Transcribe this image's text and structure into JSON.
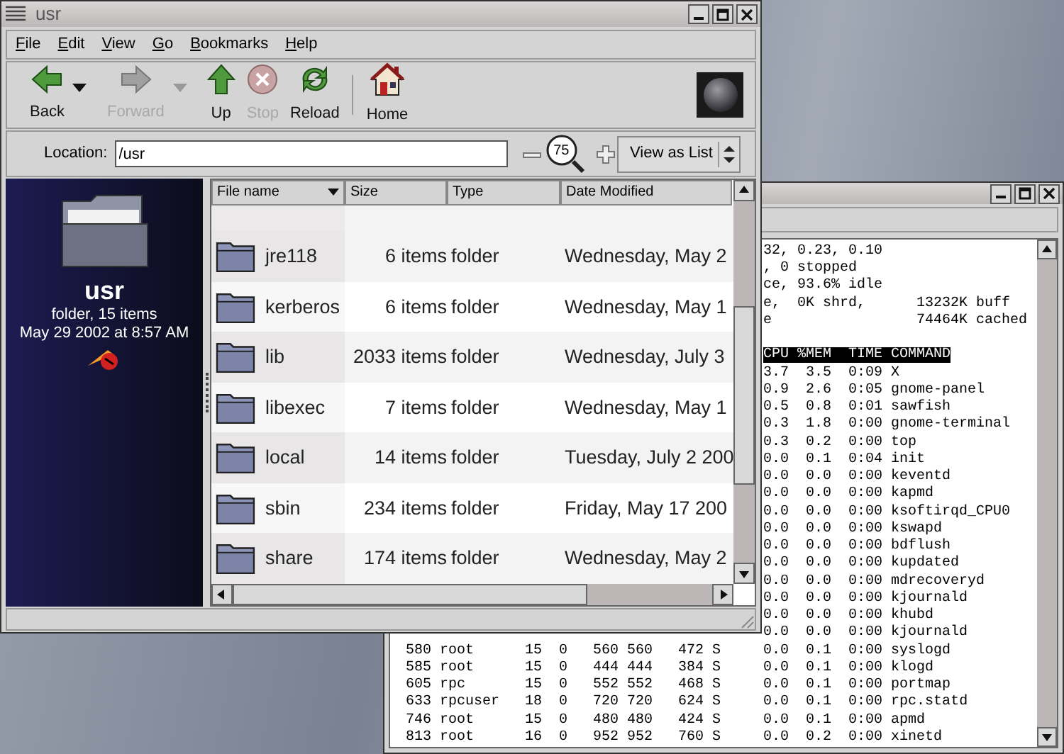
{
  "file_manager": {
    "title": "usr",
    "menu": [
      "File",
      "Edit",
      "View",
      "Go",
      "Bookmarks",
      "Help"
    ],
    "toolbar": [
      {
        "label": "Back",
        "kind": "back",
        "disabled": false,
        "dropdown": true
      },
      {
        "label": "Forward",
        "kind": "forward",
        "disabled": true,
        "dropdown": true
      },
      {
        "label": "Up",
        "kind": "up",
        "disabled": false,
        "dropdown": false
      },
      {
        "label": "Stop",
        "kind": "stop",
        "disabled": true,
        "dropdown": false
      },
      {
        "label": "Reload",
        "kind": "reload",
        "disabled": false,
        "dropdown": false
      },
      {
        "label": "Home",
        "kind": "home",
        "disabled": false,
        "dropdown": false
      }
    ],
    "location": {
      "label": "Location:",
      "value": "/usr"
    },
    "zoom": {
      "value": "75"
    },
    "view_select": {
      "value": "View as List"
    },
    "sidebar": {
      "name": "usr",
      "info": "folder, 15 items",
      "date": "May 29 2002 at 8:57 AM"
    },
    "columns": [
      {
        "label": "File name",
        "sorted": true
      },
      {
        "label": "Size",
        "sorted": false
      },
      {
        "label": "Type",
        "sorted": false
      },
      {
        "label": "Date Modified",
        "sorted": false
      }
    ],
    "rows": [
      {
        "name": "jre118",
        "size": "6 items",
        "type": "folder",
        "date": "Wednesday, May 2"
      },
      {
        "name": "kerberos",
        "size": "6 items",
        "type": "folder",
        "date": "Wednesday, May 1"
      },
      {
        "name": "lib",
        "size": "2033 items",
        "type": "folder",
        "date": "Wednesday, July 3"
      },
      {
        "name": "libexec",
        "size": "7 items",
        "type": "folder",
        "date": "Wednesday, May 1"
      },
      {
        "name": "local",
        "size": "14 items",
        "type": "folder",
        "date": "Tuesday, July 2 200"
      },
      {
        "name": "sbin",
        "size": "234 items",
        "type": "folder",
        "date": "Friday, May 17 200"
      },
      {
        "name": "share",
        "size": "174 items",
        "type": "folder",
        "date": "Wednesday, May 2"
      }
    ]
  },
  "terminal": {
    "lines": [
      {
        "kind": "partial",
        "text": "32, 0.23, 0.10"
      },
      {
        "kind": "partial",
        "text": ", 0 stopped"
      },
      {
        "kind": "partial",
        "text": "ce, 93.6% idle"
      },
      {
        "kind": "partial",
        "text": "e,  0K shrd,      13232K buff"
      },
      {
        "kind": "partial",
        "text": "e                 74464K cached"
      },
      {
        "kind": "header",
        "text": "CPU %MEM  TIME COMMAND"
      },
      {
        "kind": "partial",
        "text": "3.7  3.5  0:09 X"
      },
      {
        "kind": "partial",
        "text": "0.9  2.6  0:05 gnome-panel"
      },
      {
        "kind": "partial",
        "text": "0.5  0.8  0:01 sawfish"
      },
      {
        "kind": "partial",
        "text": "0.3  1.8  0:00 gnome-terminal"
      },
      {
        "kind": "partial",
        "text": "0.3  0.2  0:00 top"
      },
      {
        "kind": "partial",
        "text": "0.0  0.1  0:04 init"
      },
      {
        "kind": "partial",
        "text": "0.0  0.0  0:00 keventd"
      },
      {
        "kind": "partial",
        "text": "0.0  0.0  0:00 kapmd"
      },
      {
        "kind": "partial",
        "text": "0.0  0.0  0:00 ksoftirqd_CPU0"
      },
      {
        "kind": "partial",
        "text": "0.0  0.0  0:00 kswapd"
      },
      {
        "kind": "partial",
        "text": "0.0  0.0  0:00 bdflush"
      },
      {
        "kind": "partial",
        "text": "0.0  0.0  0:00 kupdated"
      },
      {
        "kind": "partial",
        "text": "0.0  0.0  0:00 mdrecoveryd"
      },
      {
        "kind": "partial",
        "text": "0.0  0.0  0:00 kjournald"
      },
      {
        "kind": "partial",
        "text": "0.0  0.0  0:00 khubd"
      },
      {
        "kind": "partial",
        "text": "0.0  0.0  0:00 kjournald"
      },
      {
        "kind": "full",
        "text": "580 root      15  0   560 560   472 S     0.0  0.1  0:00 syslogd"
      },
      {
        "kind": "full",
        "text": "585 root      15  0   444 444   384 S     0.0  0.1  0:00 klogd"
      },
      {
        "kind": "full",
        "text": "605 rpc       15  0   552 552   468 S     0.0  0.1  0:00 portmap"
      },
      {
        "kind": "full",
        "text": "633 rpcuser   18  0   720 720   624 S     0.0  0.1  0:00 rpc.statd"
      },
      {
        "kind": "full",
        "text": "746 root      15  0   480 480   424 S     0.0  0.1  0:00 apmd"
      },
      {
        "kind": "full",
        "text": "813 root      16  0   952 952   760 S     0.0  0.2  0:00 xinetd"
      }
    ]
  }
}
